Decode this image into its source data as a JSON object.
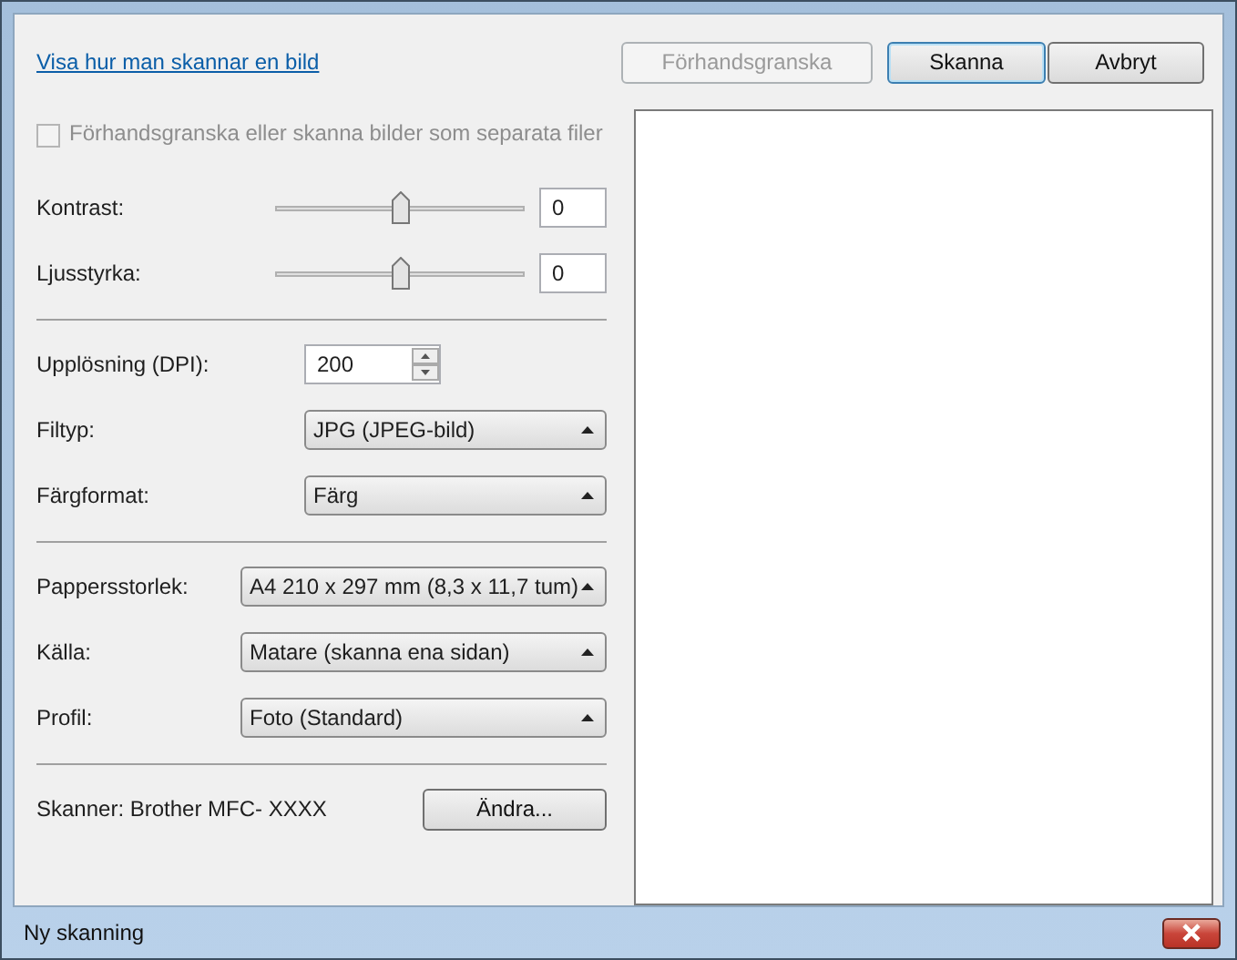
{
  "help_link": "Visa hur man skannar en bild",
  "buttons": [
    {
      "label": "Förhandsgranska",
      "disabled": true,
      "default": false
    },
    {
      "label": "Skanna",
      "disabled": false,
      "default": true
    },
    {
      "label": "Avbryt",
      "disabled": false,
      "default": false
    }
  ],
  "separate_files": {
    "label": "Förhandsgranska eller skanna bilder som separata filer",
    "checked": false,
    "disabled": true
  },
  "settings_groups": [
    [
      {
        "kind": "slider",
        "label": "Kontrast:",
        "level": 0.5,
        "value": "0"
      },
      {
        "kind": "slider",
        "label": "Ljusstyrka:",
        "level": 0.5,
        "value": "0"
      }
    ],
    [
      {
        "kind": "spinner",
        "label": "Upplösning (DPI):",
        "value": "200"
      },
      {
        "kind": "select",
        "label": "Filtyp:",
        "value": "JPG (JPEG-bild)"
      },
      {
        "kind": "select",
        "label": "Färgformat:",
        "value": "Färg"
      }
    ],
    [
      {
        "kind": "select",
        "label": "Pappersstorlek:",
        "value": "A4 210 x 297 mm (8,3 x 11,7 tum)"
      },
      {
        "kind": "select",
        "label": "Källa:",
        "value": "Matare (skanna ena sidan)"
      },
      {
        "kind": "select",
        "label": "Profil:",
        "value": "Foto (Standard)"
      }
    ]
  ],
  "scanner": {
    "label": "Skanner: Brother MFC- XXXX",
    "change_button": "Ändra..."
  },
  "window": {
    "title": "Ny skanning"
  }
}
